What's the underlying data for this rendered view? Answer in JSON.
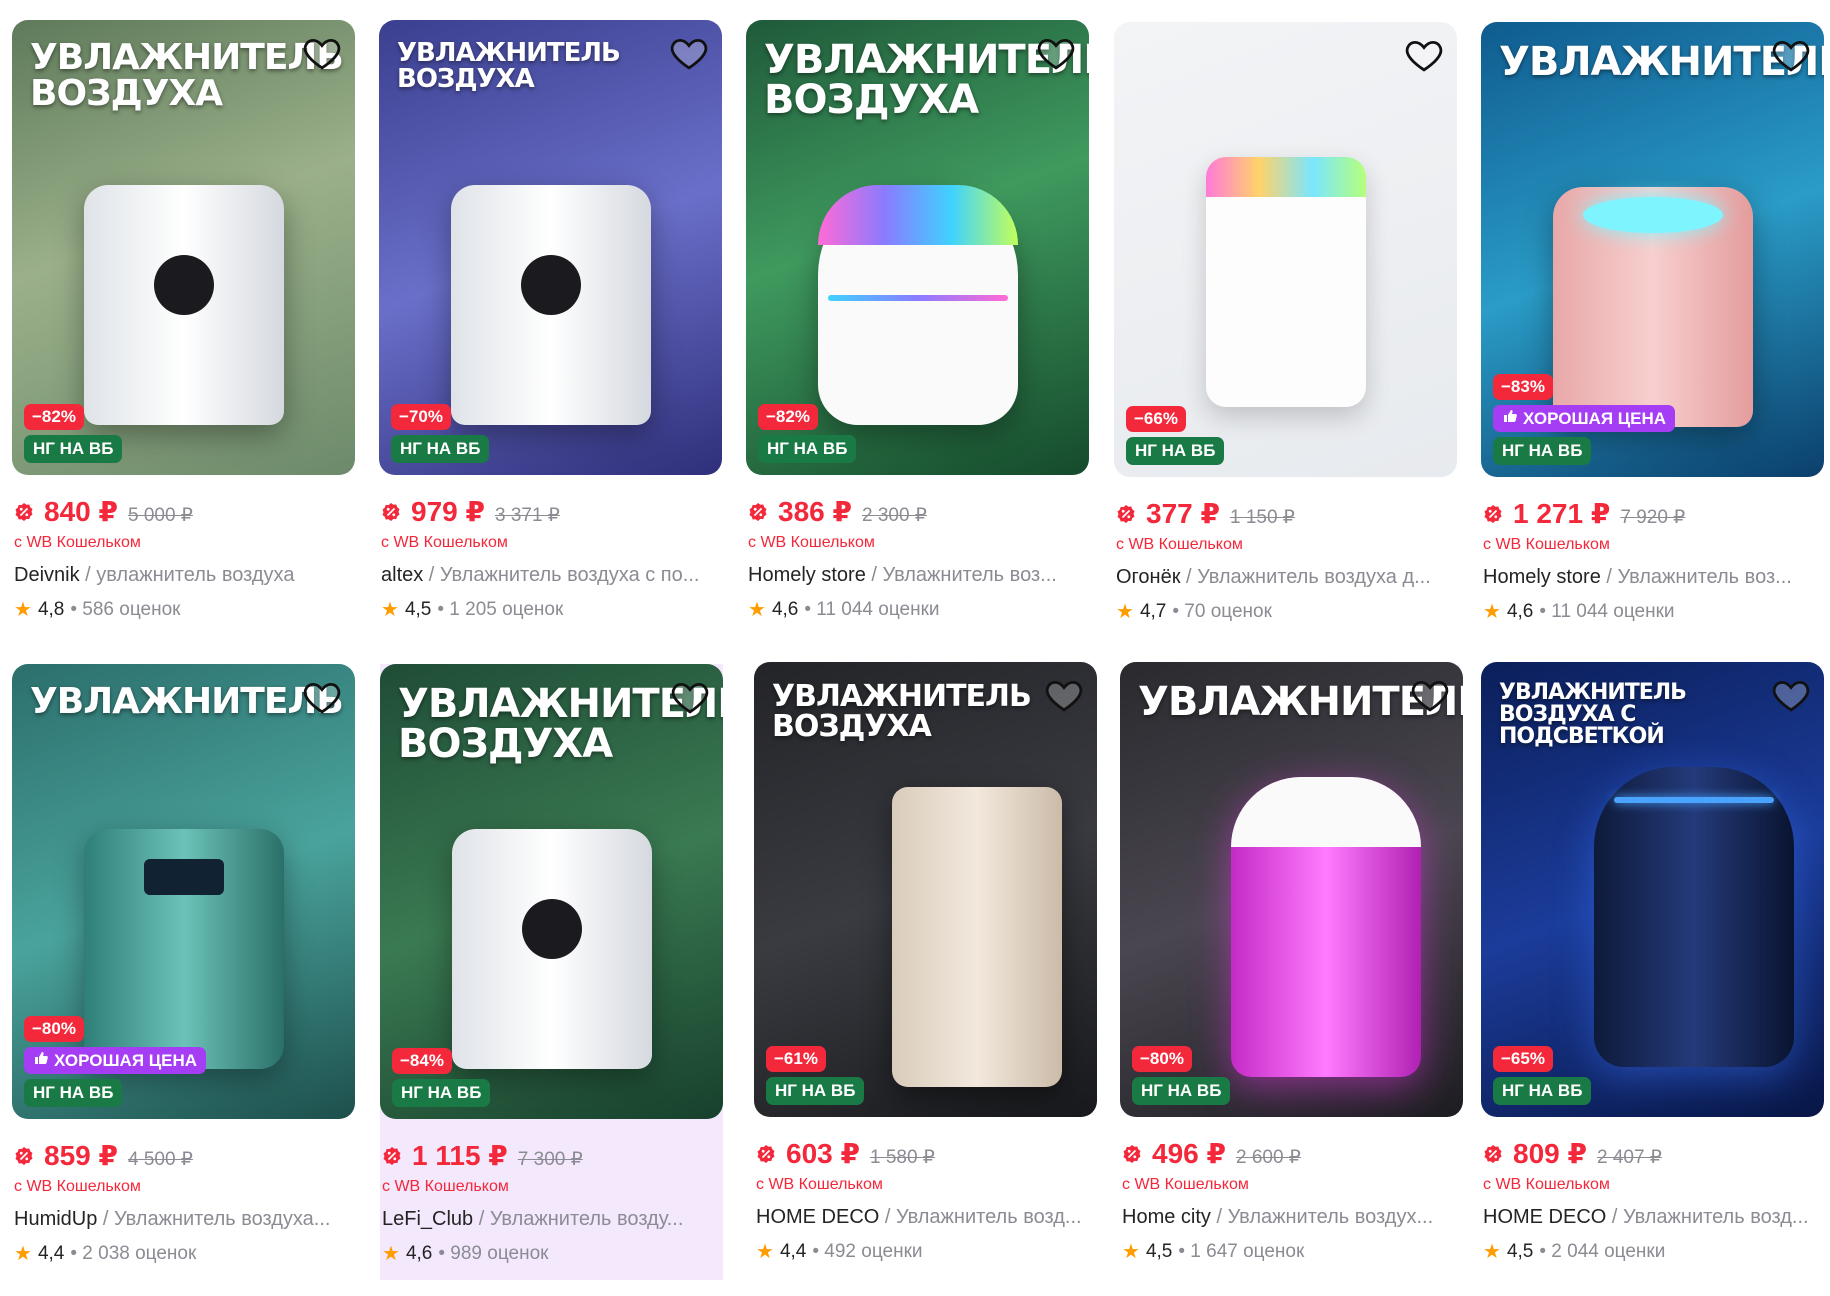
{
  "colors": {
    "price_red": "#f3283b",
    "badge_green": "#1a7a45",
    "badge_purple": "#a53df5",
    "star": "#ff9c00",
    "muted": "#8b8b94",
    "highlight_bg": "#f4e8fd"
  },
  "icons": {
    "favorite": "heart-icon",
    "rating": "star-icon",
    "wallet_price": "wallet-discount-icon",
    "good_price": "thumbs-up-icon"
  },
  "products": [
    {
      "image_heading": "УВЛАЖНИТЕЛЬ ВОЗДУХА",
      "discount": "−82%",
      "good_price": "",
      "ng_badge": "НГ НА ВБ",
      "price": "840 ₽",
      "old_price": "5 000 ₽",
      "wallet_text": "с WB Кошельком",
      "brand": "Deivnik",
      "separator": " / ",
      "name": "увлажнитель воздуха",
      "rating": "4,8",
      "reviews": "• 586 оценок"
    },
    {
      "image_heading": "УВЛАЖНИТЕЛЬ ВОЗДУХА",
      "discount": "−70%",
      "good_price": "",
      "ng_badge": "НГ НА ВБ",
      "price": "979 ₽",
      "old_price": "3 371 ₽",
      "wallet_text": "с WB Кошельком",
      "brand": "altex",
      "separator": " / ",
      "name": "Увлажнитель воздуха с по...",
      "rating": "4,5",
      "reviews": "• 1 205 оценок"
    },
    {
      "image_heading": "УВЛАЖНИТЕЛЬ воздуха",
      "discount": "−82%",
      "good_price": "",
      "ng_badge": "НГ НА ВБ",
      "price": "386 ₽",
      "old_price": "2 300 ₽",
      "wallet_text": "с WB Кошельком",
      "brand": "Homely store",
      "separator": " / ",
      "name": "Увлажнитель воз...",
      "rating": "4,6",
      "reviews": "• 11 044 оценки"
    },
    {
      "image_heading": "",
      "discount": "−66%",
      "good_price": "",
      "ng_badge": "НГ НА ВБ",
      "price": "377 ₽",
      "old_price": "1 150 ₽",
      "wallet_text": "с WB Кошельком",
      "brand": "Огонёк",
      "separator": " / ",
      "name": "Увлажнитель воздуха д...",
      "rating": "4,7",
      "reviews": "• 70 оценок"
    },
    {
      "image_heading": "УВЛАЖНИТЕЛЬ",
      "discount": "−83%",
      "good_price": "ХОРОШАЯ ЦЕНА",
      "ng_badge": "НГ НА ВБ",
      "price": "1 271 ₽",
      "old_price": "7 920 ₽",
      "wallet_text": "с WB Кошельком",
      "brand": "Homely store",
      "separator": " / ",
      "name": "Увлажнитель воз...",
      "rating": "4,6",
      "reviews": "• 11 044 оценки"
    },
    {
      "image_heading": "УВЛАЖНИТЕЛЬ",
      "discount": "−80%",
      "good_price": "ХОРОШАЯ ЦЕНА",
      "ng_badge": "НГ НА ВБ",
      "price": "859 ₽",
      "old_price": "4 500 ₽",
      "wallet_text": "с WB Кошельком",
      "brand": "HumidUp",
      "separator": " / ",
      "name": "Увлажнитель воздуха...",
      "rating": "4,4",
      "reviews": "• 2 038 оценок"
    },
    {
      "image_heading": "УВЛАЖНИТЕЛЬ ВОЗДУХА",
      "discount": "−84%",
      "good_price": "",
      "ng_badge": "НГ НА ВБ",
      "price": "1 115 ₽",
      "old_price": "7 300 ₽",
      "wallet_text": "с WB Кошельком",
      "brand": "LeFi_Club",
      "separator": " / ",
      "name": "Увлажнитель возду...",
      "rating": "4,6",
      "reviews": "• 989 оценок"
    },
    {
      "image_heading": "УВЛАЖНИТЕЛЬ ВОЗДУХА",
      "discount": "−61%",
      "good_price": "",
      "ng_badge": "НГ НА ВБ",
      "price": "603 ₽",
      "old_price": "1 580 ₽",
      "wallet_text": "с WB Кошельком",
      "brand": "HOME DECO",
      "separator": " / ",
      "name": "Увлажнитель возд...",
      "rating": "4,4",
      "reviews": "• 492 оценки"
    },
    {
      "image_heading": "УВЛАЖНИТЕЛЬ",
      "discount": "−80%",
      "good_price": "",
      "ng_badge": "НГ НА ВБ",
      "price": "496 ₽",
      "old_price": "2 600 ₽",
      "wallet_text": "с WB Кошельком",
      "brand": "Home city",
      "separator": " / ",
      "name": "Увлажнитель воздух...",
      "rating": "4,5",
      "reviews": "• 1 647 оценок"
    },
    {
      "image_heading": "УВЛАЖНИТЕЛЬ ВОЗДУХА С ПОДСВЕТКОЙ",
      "discount": "−65%",
      "good_price": "",
      "ng_badge": "НГ НА ВБ",
      "price": "809 ₽",
      "old_price": "2 407 ₽",
      "wallet_text": "с WB Кошельком",
      "brand": "HOME DECO",
      "separator": " / ",
      "name": "Увлажнитель возд...",
      "rating": "4,5",
      "reviews": "• 2 044 оценки"
    }
  ]
}
